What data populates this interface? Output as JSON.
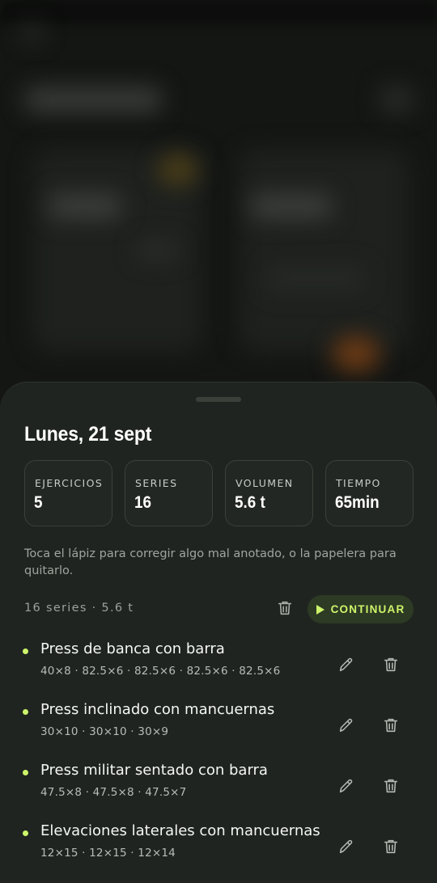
{
  "sheet": {
    "title": "Lunes, 21 sept",
    "stats": [
      {
        "label": "EJERCICIOS",
        "value": "5"
      },
      {
        "label": "SERIES",
        "value": "16"
      },
      {
        "label": "VOLUMEN",
        "value": "5.6 t"
      },
      {
        "label": "TIEMPO",
        "value": "65min"
      }
    ],
    "hint": "Toca el lápiz para corregir algo mal anotado, o la papelera para quitarlo.",
    "summary": "16 series · 5.6 t",
    "continue_label": "CONTINUAR",
    "accent_color": "#cdf56a",
    "exercises": [
      {
        "name": "Press de banca con barra",
        "sets": "40×8 · 82.5×6 · 82.5×6 · 82.5×6 · 82.5×6"
      },
      {
        "name": "Press inclinado con mancuernas",
        "sets": "30×10 · 30×10 · 30×9"
      },
      {
        "name": "Press militar sentado con barra",
        "sets": "47.5×8 · 47.5×8 · 47.5×7"
      },
      {
        "name": "Elevaciones laterales con mancuernas",
        "sets": "12×15 · 12×15 · 12×14"
      }
    ],
    "icons": {
      "edit": "pencil-icon",
      "delete": "trash-icon",
      "continue": "play-icon"
    }
  }
}
